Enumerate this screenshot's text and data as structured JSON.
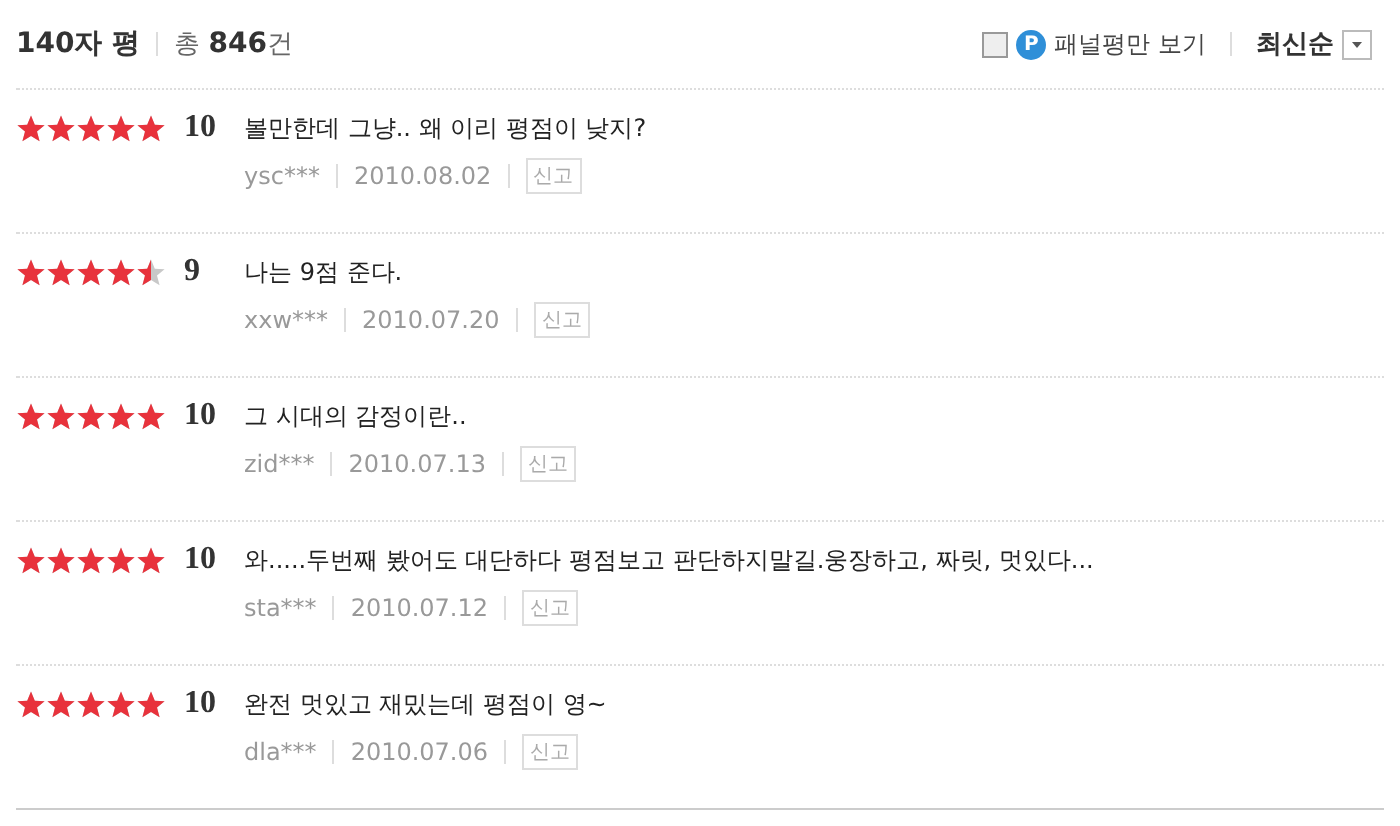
{
  "header": {
    "title": "140자 평",
    "total": "총 **846**건",
    "panel_filter": {
      "label": "패널평만 보기",
      "checked": false,
      "badge": "P"
    },
    "sort": {
      "label": "최신순"
    }
  },
  "reviews": [
    {
      "stars": 5,
      "score": "10",
      "text": "볼만한데 그냥.. 왜 이리 평점이 낮지?",
      "user": "ysc***",
      "date": "2010.08.02",
      "report": "신고"
    },
    {
      "stars": 4.5,
      "score": "9",
      "text": "나는 9점 준다.",
      "user": "xxw***",
      "date": "2010.07.20",
      "report": "신고"
    },
    {
      "stars": 5,
      "score": "10",
      "text": "그 시대의 감정이란..",
      "user": "zid***",
      "date": "2010.07.13",
      "report": "신고"
    },
    {
      "stars": 5,
      "score": "10",
      "text": "와.....두번째 봤어도 대단하다 평점보고 판단하지말길.웅장하고, 짜릿, 멋있다...",
      "user": "sta***",
      "date": "2010.07.12",
      "report": "신고"
    },
    {
      "stars": 5,
      "score": "10",
      "text": "완전 멋있고 재밌는데 평점이 영~",
      "user": "dla***",
      "date": "2010.07.06",
      "report": "신고"
    }
  ]
}
